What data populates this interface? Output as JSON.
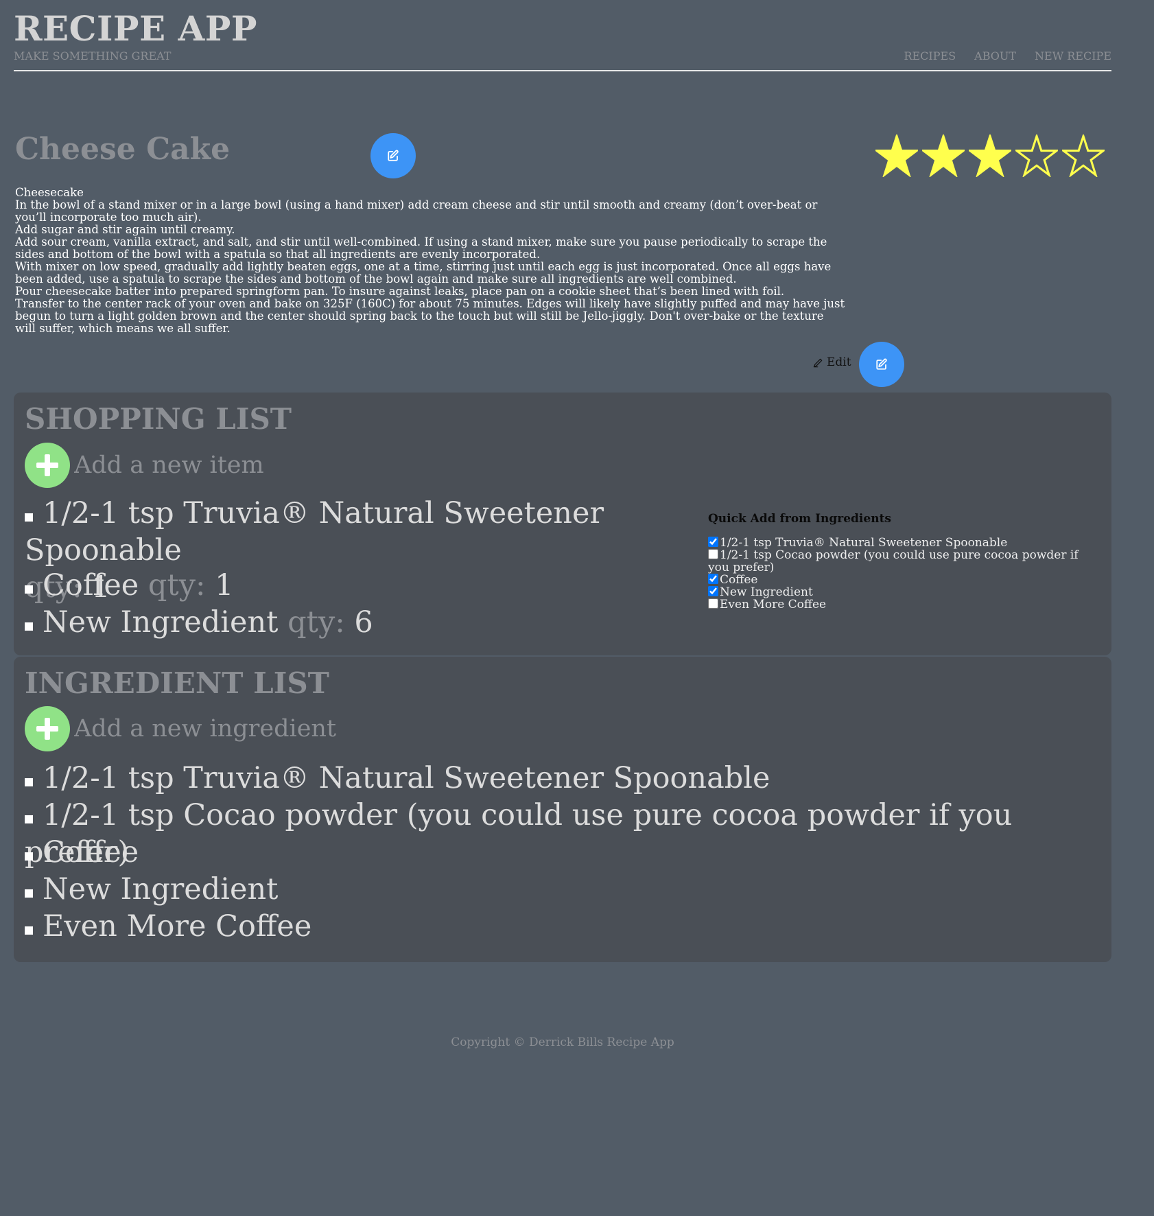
{
  "app": {
    "title": "RECIPE APP",
    "tagline": "MAKE SOMETHING GREAT"
  },
  "nav": {
    "items": [
      "RECIPES",
      "ABOUT",
      "NEW RECIPE"
    ]
  },
  "recipe": {
    "title": "Cheese Cake",
    "rating": 3,
    "max_rating": 5,
    "star_color": "#ffff4d",
    "description": [
      "Cheesecake",
      "In the bowl of a stand mixer or in a large bowl (using a hand mixer) add cream cheese and stir until smooth and creamy (don’t over-beat or you’ll incorporate too much air).",
      "Add sugar and stir again until creamy.",
      "Add sour cream, vanilla extract, and salt, and stir until well-combined. If using a stand mixer, make sure you pause periodically to scrape the sides and bottom of the bowl with a spatula so that all ingredients are evenly incorporated.",
      "With mixer on low speed, gradually add lightly beaten eggs, one at a time, stirring just until each egg is just incorporated. Once all eggs have been added, use a spatula to scrape the sides and bottom of the bowl again and make sure all ingredients are well combined.",
      "Pour cheesecake batter into prepared springform pan. To insure against leaks, place pan on a cookie sheet that’s been lined with foil.",
      "Transfer to the center rack of your oven and bake on 325F (160C) for about 75 minutes. Edges will likely have slightly puffed and may have just begun to turn a light golden brown and the center should spring back to the touch but will still be Jello-jiggly. Don't over-bake or the texture will suffer, which means we all suffer."
    ],
    "edit_label": "Edit"
  },
  "shopping": {
    "title": "SHOPPING LIST",
    "add_placeholder": "Add a new item",
    "qty_label": "qty:",
    "items": [
      {
        "name": "1/2-1 tsp Truvia® Natural Sweetener Spoonable",
        "qty": "1"
      },
      {
        "name": "Coffee",
        "qty": "1"
      },
      {
        "name": "New Ingredient",
        "qty": "6"
      }
    ]
  },
  "quick_add": {
    "title": "Quick Add from Ingredients",
    "items": [
      {
        "label": "1/2-1 tsp Truvia® Natural Sweetener Spoonable",
        "checked": true
      },
      {
        "label": "1/2-1 tsp Cocao powder (you could use pure cocoa powder if you prefer)",
        "checked": false
      },
      {
        "label": "Coffee",
        "checked": true
      },
      {
        "label": "New Ingredient",
        "checked": true
      },
      {
        "label": "Even More Coffee",
        "checked": false
      }
    ]
  },
  "ingredients": {
    "title": "INGREDIENT LIST",
    "add_placeholder": "Add a new ingredient",
    "items": [
      "1/2-1 tsp Truvia® Natural Sweetener Spoonable",
      "1/2-1 tsp Cocao powder (you could use pure cocoa powder if you prefer)",
      "Coffee",
      "New Ingredient",
      "Even More Coffee"
    ]
  },
  "footer": {
    "text": "Copyright © Derrick Bills Recipe App"
  },
  "colors": {
    "background": "#525c67",
    "panel": "#4a4f56",
    "fab_blue": "#3d94f6",
    "add_green": "#90e287",
    "muted_text": "#8c8f94"
  },
  "icons": {
    "edit_fab": "edit-square-icon",
    "edit_link": "pencil-icon",
    "add": "plus-icon",
    "star": "star-icon"
  }
}
